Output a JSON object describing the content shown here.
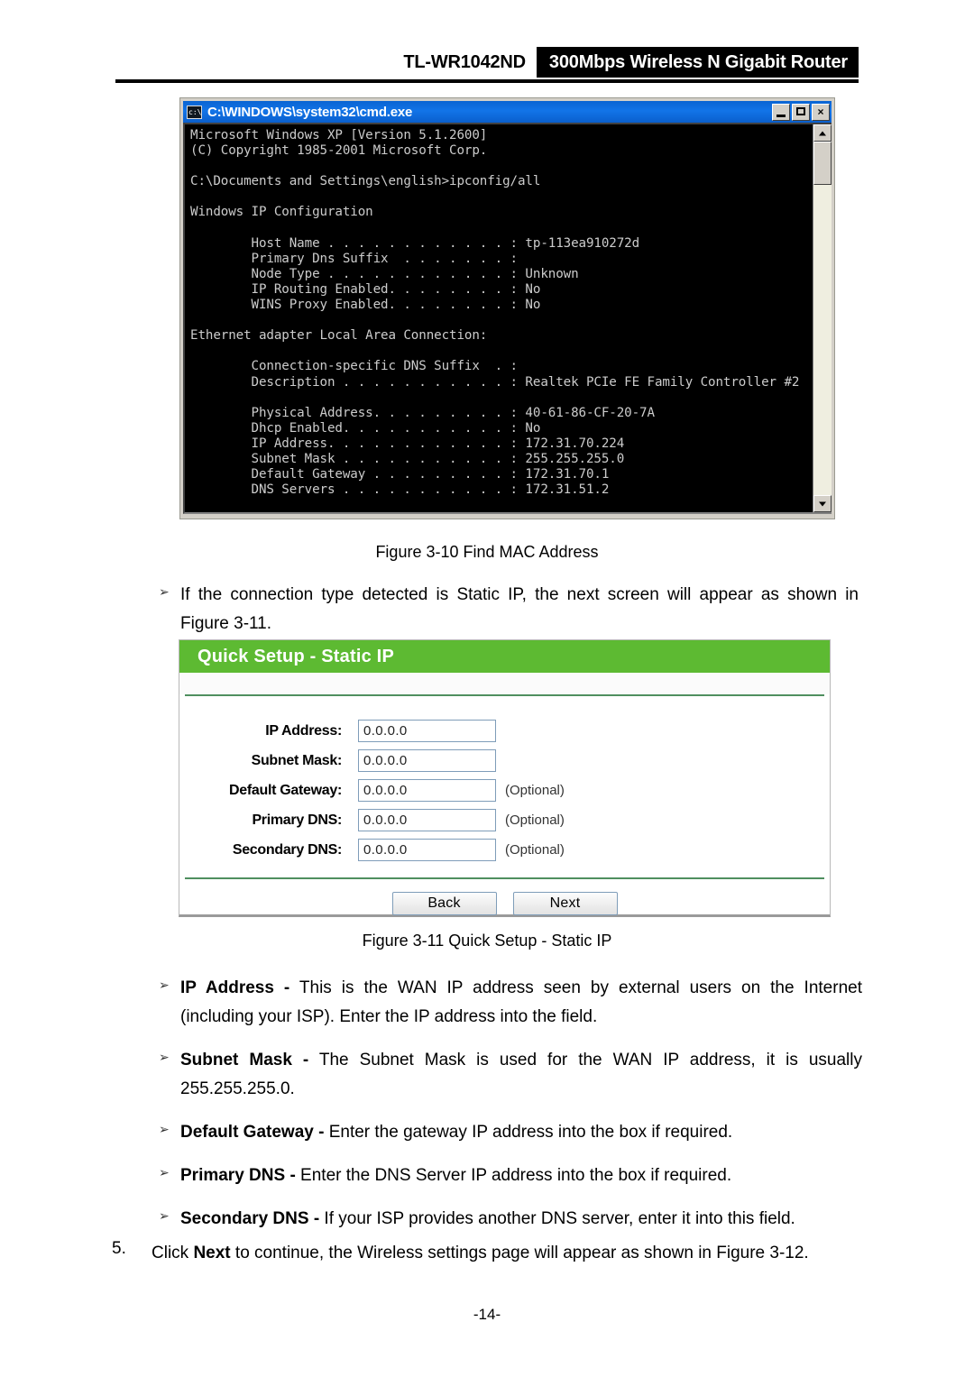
{
  "header": {
    "model": "TL-WR1042ND",
    "tagline": "300Mbps Wireless N Gigabit Router"
  },
  "cmd_window": {
    "title": "C:\\WINDOWS\\system32\\cmd.exe",
    "icon": "cmd-icon",
    "minimize_label": "Minimize",
    "maximize_label": "Maximize",
    "close_label": "×",
    "console_lines": [
      "Microsoft Windows XP [Version 5.1.2600]",
      "(C) Copyright 1985-2001 Microsoft Corp.",
      "",
      "C:\\Documents and Settings\\english>ipconfig/all",
      "",
      "Windows IP Configuration",
      "",
      "        Host Name . . . . . . . . . . . . : tp-113ea910272d",
      "        Primary Dns Suffix  . . . . . . . :",
      "        Node Type . . . . . . . . . . . . : Unknown",
      "        IP Routing Enabled. . . . . . . . : No",
      "        WINS Proxy Enabled. . . . . . . . : No",
      "",
      "Ethernet adapter Local Area Connection:",
      "",
      "        Connection-specific DNS Suffix  . :",
      "        Description . . . . . . . . . . . : Realtek PCIe FE Family Controller #2",
      "",
      "        Physical Address. . . . . . . . . : 40-61-86-CF-20-7A",
      "        Dhcp Enabled. . . . . . . . . . . : No",
      "        IP Address. . . . . . . . . . . . : 172.31.70.224",
      "        Subnet Mask . . . . . . . . . . . : 255.255.255.0",
      "        Default Gateway . . . . . . . . . : 172.31.70.1",
      "        DNS Servers . . . . . . . . . . . : 172.31.51.2"
    ]
  },
  "figure_10_caption": "Figure 3-10 Find MAC Address",
  "bullet_static_ip": {
    "marker": "➢",
    "text": "If the connection type detected is Static IP, the next screen will appear as shown in Figure 3-11."
  },
  "router_panel": {
    "header_title": "Quick Setup - Static IP",
    "accent_color": "#5dba32",
    "fields": [
      {
        "label": "IP Address:",
        "value": "0.0.0.0",
        "optional": ""
      },
      {
        "label": "Subnet Mask:",
        "value": "0.0.0.0",
        "optional": ""
      },
      {
        "label": "Default Gateway:",
        "value": "0.0.0.0",
        "optional": "(Optional)"
      },
      {
        "label": "Primary DNS:",
        "value": "0.0.0.0",
        "optional": "(Optional)"
      },
      {
        "label": "Secondary DNS:",
        "value": "0.0.0.0",
        "optional": "(Optional)"
      }
    ],
    "back_label": "Back",
    "next_label": "Next"
  },
  "figure_11_caption": "Figure 3-11   Quick Setup - Static IP",
  "descriptions": [
    {
      "marker": "➢",
      "term": "IP Address -",
      "text": " This is the WAN IP address seen by external users on the Internet (including your ISP). Enter the IP address into the field."
    },
    {
      "marker": "➢",
      "term": "Subnet Mask -",
      "text": " The Subnet Mask is used for the WAN IP address, it is usually 255.255.255.0."
    },
    {
      "marker": "➢",
      "term": "Default Gateway -",
      "text": " Enter the gateway IP address into the box if required."
    },
    {
      "marker": "➢",
      "term": "Primary DNS -",
      "text": " Enter the DNS Server IP address into the box if required."
    },
    {
      "marker": "➢",
      "term": "Secondary DNS -",
      "text": " If your ISP provides another DNS server, enter it into this field."
    }
  ],
  "step_5": {
    "number": "5.",
    "prefix": "Click ",
    "bold": "Next",
    "suffix": " to continue, the Wireless settings page will appear as shown in Figure 3-12."
  },
  "page_number": "-14-"
}
